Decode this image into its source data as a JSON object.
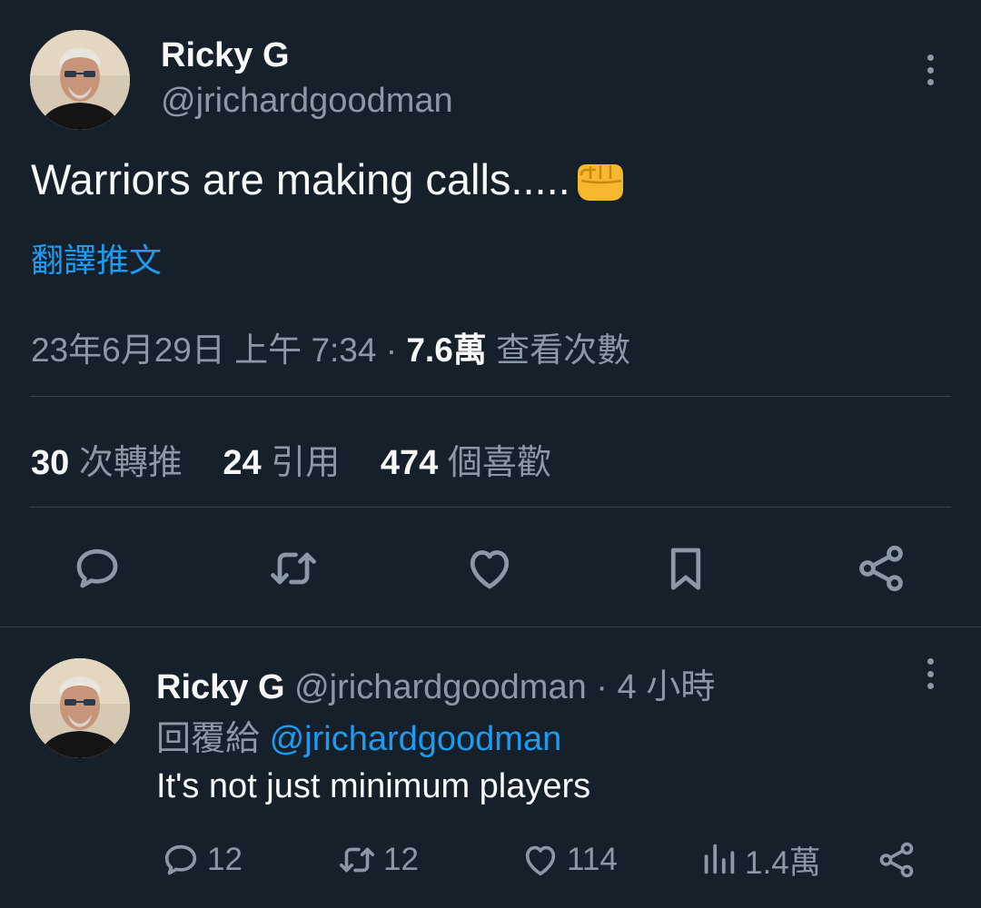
{
  "main_tweet": {
    "author_name": "Ricky G",
    "author_handle": "@jrichardgoodman",
    "text": "Warriors are making calls.....",
    "emoji_icon": "oncoming-fist-icon",
    "translate_label": "翻譯推文",
    "timestamp": "23年6月29日 上午 7:34",
    "separator": "·",
    "view_count": "7.6萬",
    "view_label": "查看次數",
    "stats": {
      "retweets": "30",
      "retweets_label": "次轉推",
      "quotes": "24",
      "quotes_label": "引用",
      "likes": "474",
      "likes_label": "個喜歡"
    },
    "actions": [
      "reply-icon",
      "retweet-icon",
      "like-icon",
      "bookmark-icon",
      "share-icon"
    ]
  },
  "reply_tweet": {
    "author_name": "Ricky G",
    "author_handle": "@jrichardgoodman",
    "separator": "·",
    "time_ago": "4 小時",
    "reply_to_label": "回覆給",
    "reply_to_handle": "@jrichardgoodman",
    "text": "It's not just minimum players",
    "replies": "12",
    "retweets": "12",
    "likes": "114",
    "views": "1.4萬"
  },
  "colors": {
    "background": "#15202b",
    "primary_text": "#f7f9f9",
    "secondary_text": "#8b98a5",
    "accent": "#1d9bf0",
    "divider": "#38444d"
  }
}
